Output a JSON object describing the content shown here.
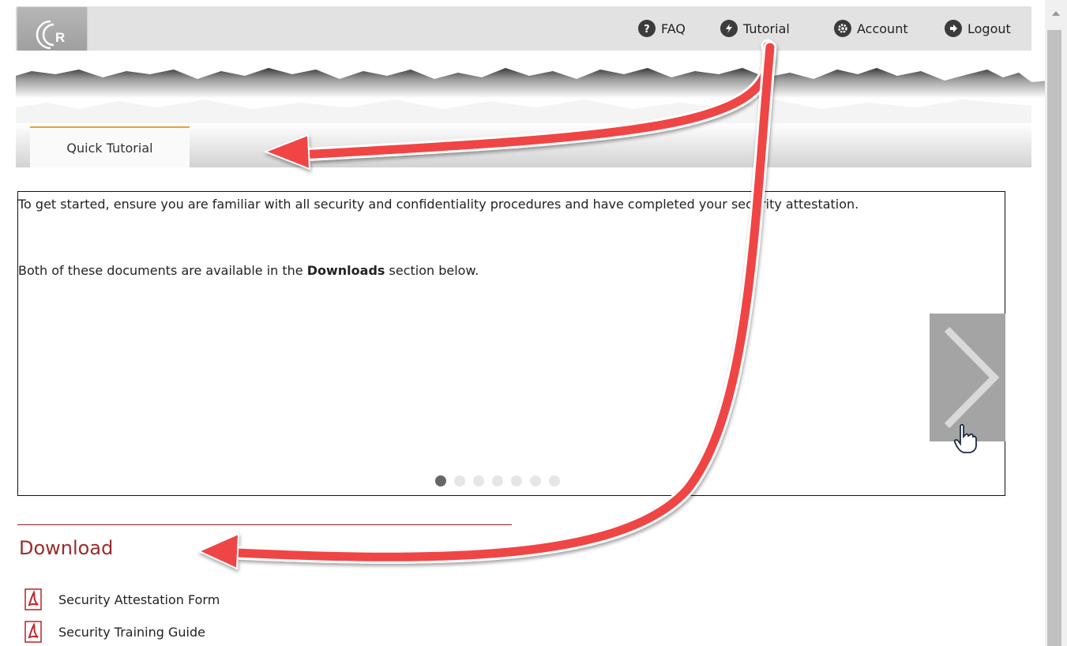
{
  "header": {
    "logo_letter": "R",
    "nav": [
      {
        "label": "FAQ",
        "icon": "question-icon"
      },
      {
        "label": "Tutorial",
        "icon": "bolt-icon"
      },
      {
        "label": "Account",
        "icon": "gear-icon"
      },
      {
        "label": "Logout",
        "icon": "logout-icon"
      }
    ]
  },
  "tabs": [
    {
      "label": "Quick Tutorial",
      "active": true
    }
  ],
  "tutorial": {
    "paragraph1": "To get started, ensure you are familiar with all security and confidentiality procedures and have completed your security attestation.",
    "paragraph2_prefix": "Both of these documents are available in the ",
    "paragraph2_bold": "Downloads",
    "paragraph2_suffix": " section below.",
    "slide_count": 7,
    "active_slide": 1
  },
  "download": {
    "heading": "Download",
    "items": [
      {
        "label": "Security Attestation Form",
        "icon": "pdf-icon"
      },
      {
        "label": "Security Training Guide",
        "icon": "pdf-icon"
      }
    ]
  },
  "colors": {
    "accent_tab": "#e8a23a",
    "heading": "#9c2a2a",
    "annotation_arrow": "#f04545"
  }
}
